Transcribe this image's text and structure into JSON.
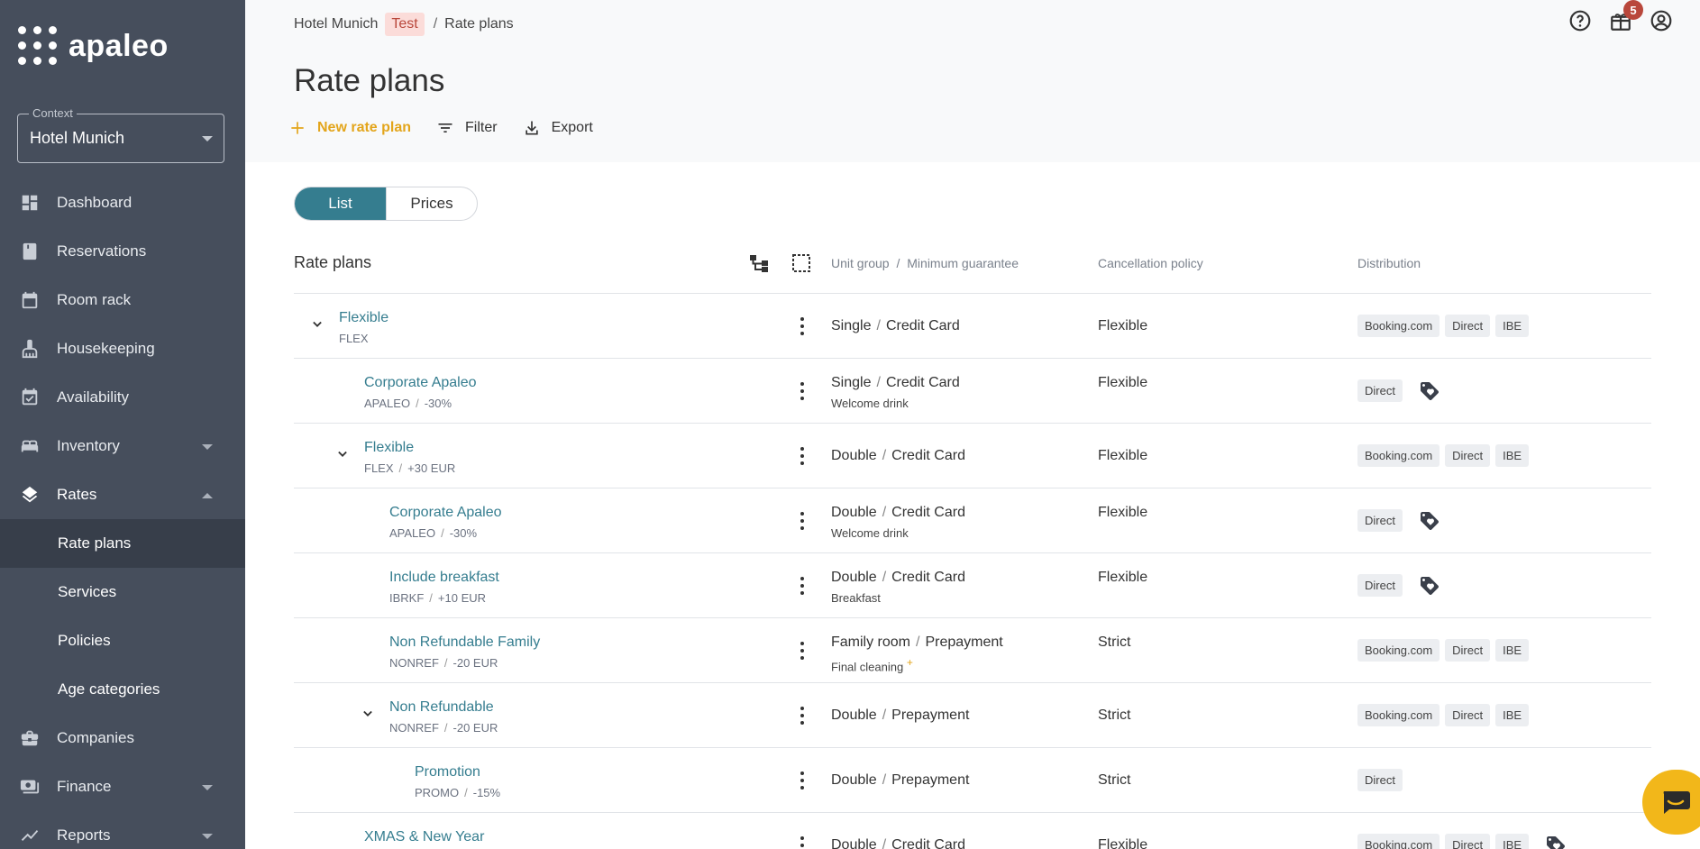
{
  "app": {
    "logo_text": "apaleo"
  },
  "context": {
    "legend": "Context",
    "value": "Hotel Munich"
  },
  "nav": {
    "items": [
      {
        "label": "Dashboard",
        "icon": "dashboard-icon"
      },
      {
        "label": "Reservations",
        "icon": "book-icon"
      },
      {
        "label": "Room rack",
        "icon": "calendar-icon"
      },
      {
        "label": "Housekeeping",
        "icon": "broom-icon"
      },
      {
        "label": "Availability",
        "icon": "calendar-check-icon"
      },
      {
        "label": "Inventory",
        "icon": "bed-icon",
        "expandable": true
      },
      {
        "label": "Rates",
        "icon": "layers-icon",
        "expanded": true
      }
    ],
    "sub_items": [
      "Rate plans",
      "Services",
      "Policies",
      "Age categories"
    ],
    "items_after": [
      {
        "label": "Companies",
        "icon": "briefcase-icon"
      },
      {
        "label": "Finance",
        "icon": "money-icon",
        "expandable": true
      },
      {
        "label": "Reports",
        "icon": "chart-icon",
        "expandable": true
      }
    ]
  },
  "breadcrumb": {
    "property": "Hotel Munich",
    "env_badge": "Test",
    "separator": "/",
    "current": "Rate plans"
  },
  "page": {
    "title": "Rate plans"
  },
  "toolbar": {
    "new_label": "New rate plan",
    "filter_label": "Filter",
    "export_label": "Export"
  },
  "header": {
    "notification_count": "5"
  },
  "view_toggle": {
    "list": "List",
    "prices": "Prices"
  },
  "table": {
    "title": "Rate plans",
    "col_unit": "Unit group",
    "col_sep": "/",
    "col_guarantee": "Minimum guarantee",
    "col_cancel": "Cancellation policy",
    "col_dist": "Distribution",
    "rows": [
      {
        "name": "Flexible",
        "code": "FLEX",
        "mod": "",
        "unit": "Single",
        "guarantee": "Credit Card",
        "extra": "",
        "policy": "Flexible",
        "channels": [
          "Booking.com",
          "Direct",
          "IBE"
        ],
        "tag": false
      },
      {
        "name": "Corporate Apaleo",
        "code": "APALEO",
        "mod": "-30%",
        "unit": "Single",
        "guarantee": "Credit Card",
        "extra": "Welcome drink",
        "policy": "Flexible",
        "channels": [
          "Direct"
        ],
        "tag": true
      },
      {
        "name": "Flexible",
        "code": "FLEX",
        "mod": "+30 EUR",
        "unit": "Double",
        "guarantee": "Credit Card",
        "extra": "",
        "policy": "Flexible",
        "channels": [
          "Booking.com",
          "Direct",
          "IBE"
        ],
        "tag": false
      },
      {
        "name": "Corporate Apaleo",
        "code": "APALEO",
        "mod": "-30%",
        "unit": "Double",
        "guarantee": "Credit Card",
        "extra": "Welcome drink",
        "policy": "Flexible",
        "channels": [
          "Direct"
        ],
        "tag": true
      },
      {
        "name": "Include breakfast",
        "code": "IBRKF",
        "mod": "+10 EUR",
        "unit": "Double",
        "guarantee": "Credit Card",
        "extra": "Breakfast",
        "policy": "Flexible",
        "channels": [
          "Direct"
        ],
        "tag": true
      },
      {
        "name": "Non Refundable Family",
        "code": "NONREF",
        "mod": "-20 EUR",
        "unit": "Family room",
        "guarantee": "Prepayment",
        "extra": "Final cleaning",
        "extra_mark": "+",
        "policy": "Strict",
        "channels": [
          "Booking.com",
          "Direct",
          "IBE"
        ],
        "tag": false
      },
      {
        "name": "Non Refundable",
        "code": "NONREF",
        "mod": "-20 EUR",
        "unit": "Double",
        "guarantee": "Prepayment",
        "extra": "",
        "policy": "Strict",
        "channels": [
          "Booking.com",
          "Direct",
          "IBE"
        ],
        "tag": false
      },
      {
        "name": "Promotion",
        "code": "PROMO",
        "mod": "-15%",
        "unit": "Double",
        "guarantee": "Prepayment",
        "extra": "",
        "policy": "Strict",
        "channels": [
          "Direct"
        ],
        "tag": false
      },
      {
        "name": "XMAS & New Year",
        "code": "",
        "mod": "",
        "unit": "Double",
        "guarantee": "Credit Card",
        "extra": "",
        "policy": "Flexible",
        "channels": [
          "Booking.com",
          "Direct",
          "IBE"
        ],
        "tag": true
      }
    ]
  },
  "colors": {
    "sidebar": "#464e5c",
    "accent": "#357d8f",
    "primary_action": "#e3a51b",
    "chat": "#f2b71a"
  }
}
